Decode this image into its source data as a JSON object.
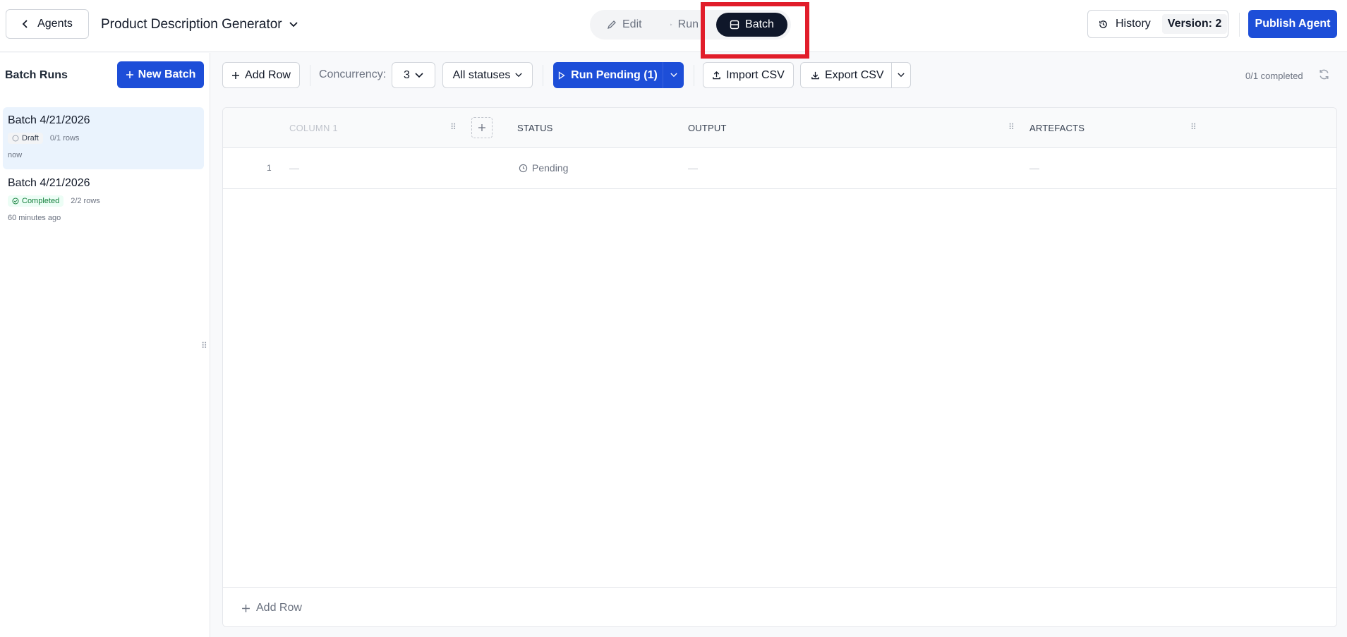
{
  "header": {
    "back_label": "Agents",
    "title": "Product Description Generator",
    "modes": {
      "edit": "Edit",
      "run": "Run",
      "batch": "Batch"
    },
    "history_label": "History",
    "version_label": "Version: 2",
    "publish_label": "Publish Agent"
  },
  "sidebar": {
    "title": "Batch Runs",
    "new_batch_label": "New Batch",
    "batches": [
      {
        "name": "Batch 4/21/2026",
        "status": "Draft",
        "rows": "0/1 rows",
        "time": "now"
      },
      {
        "name": "Batch 4/21/2026",
        "status": "Completed",
        "rows": "2/2 rows",
        "time": "60 minutes ago"
      }
    ]
  },
  "toolbar": {
    "add_row_label": "Add Row",
    "concurrency_label": "Concurrency:",
    "concurrency_value": "3",
    "status_filter": "All statuses",
    "run_pending_label": "Run Pending (1)",
    "import_label": "Import CSV",
    "export_label": "Export CSV",
    "completed_text": "0/1 completed"
  },
  "table": {
    "columns": {
      "col1": "COLUMN 1",
      "status": "STATUS",
      "output": "OUTPUT",
      "artefacts": "ARTEFACTS"
    },
    "rows": [
      {
        "num": "1",
        "col1": "—",
        "status": "Pending",
        "output": "—",
        "artefacts": "—"
      }
    ],
    "footer_add_row": "Add Row"
  },
  "colors": {
    "primary": "#1d4ed8",
    "dark": "#0f172a",
    "highlight": "#e11d2a",
    "success": "#15803d"
  }
}
